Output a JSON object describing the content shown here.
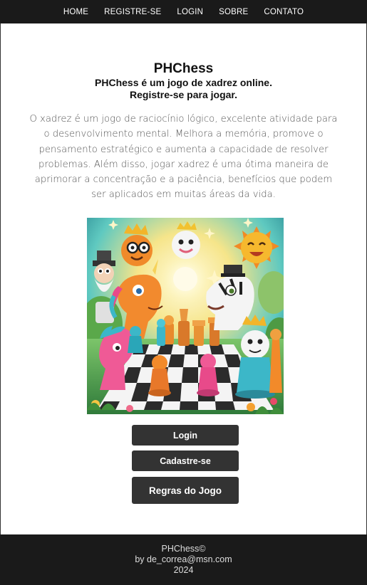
{
  "nav": {
    "items": [
      "HOME",
      "REGISTRE-SE",
      "LOGIN",
      "SOBRE",
      "CONTATO"
    ]
  },
  "main": {
    "title": "PHChess",
    "subtitle_line1": "PHChess é um jogo de xadrez online.",
    "subtitle_line2": "Registre-se para jogar.",
    "description": "O xadrez é um jogo de raciocínio lógico, excelente atividade para o desenvolvimento mental. Melhora a memória, promove o pensamento estratégico e aumenta a capacidade de resolver problemas. Além disso, jogar xadrez é uma ótima maneira de aprimorar a concentração e a paciência, benefícios que podem ser aplicados em muitas áreas da vida."
  },
  "buttons": {
    "login": "Login",
    "signup": "Cadastre-se",
    "rules": "Regras do Jogo"
  },
  "footer": {
    "brand": "PHChess©",
    "author": "by de_correa@msn.com",
    "year": "2024"
  }
}
